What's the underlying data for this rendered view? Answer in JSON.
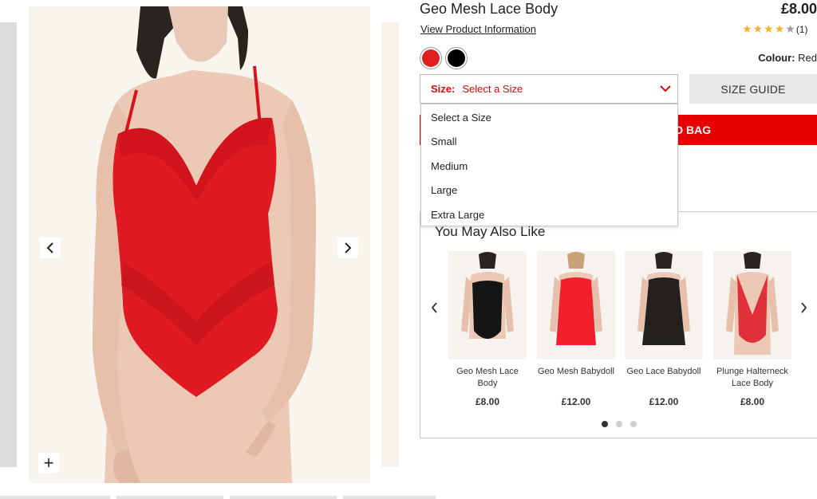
{
  "product": {
    "title": "Geo Mesh Lace Body",
    "price": "£8.00",
    "view_info_link": "View Product Information",
    "rating": {
      "stars": 4,
      "max": 5,
      "count_text": "(1)"
    },
    "colour_label": "Colour:",
    "colour_value": "Red",
    "swatches": [
      {
        "name": "Red",
        "color": "#e02020"
      },
      {
        "name": "Black",
        "color": "#000000"
      }
    ],
    "accent_color": "#e60000"
  },
  "size": {
    "label": "Size:",
    "value": "Select a Size",
    "options": [
      "Select a Size",
      "Small",
      "Medium",
      "Large",
      "Extra Large"
    ]
  },
  "size_guide": "SIZE GUIDE",
  "add_to_bag_visible": "D TO BAG",
  "recommendations": {
    "title": "You May Also Like",
    "items": [
      {
        "name": "Geo Mesh Lace Body",
        "price": "£8.00"
      },
      {
        "name": "Geo Mesh Babydoll",
        "price": "£12.00"
      },
      {
        "name": "Geo Lace Babydoll",
        "price": "£12.00"
      },
      {
        "name": "Plunge Halterneck Lace Body",
        "price": "£8.00"
      }
    ],
    "pages": 3,
    "active_page": 1
  }
}
